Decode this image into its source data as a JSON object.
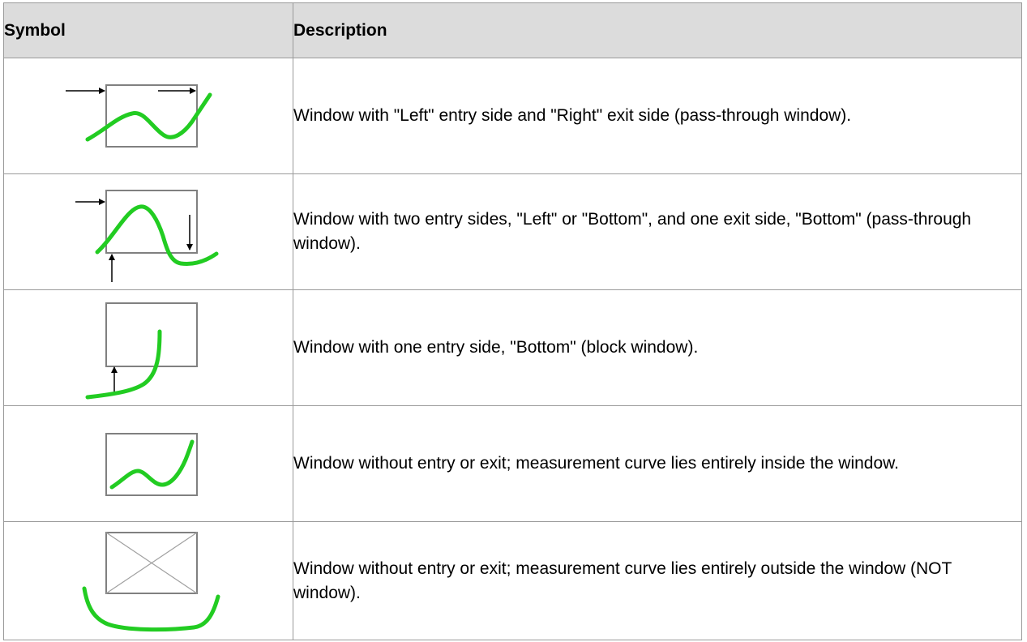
{
  "table": {
    "headers": {
      "symbol": "Symbol",
      "description": "Description"
    },
    "rows": [
      {
        "symbol_icon": "pass-through-window-left-right-icon",
        "description": "Window with \"Left\" entry side and \"Right\" exit side (pass-through window)."
      },
      {
        "symbol_icon": "pass-through-window-left-bottom-icon",
        "description": "Window with two entry sides, \"Left\" or \"Bottom\", and one exit side, \"Bottom\" (pass-through window)."
      },
      {
        "symbol_icon": "block-window-bottom-icon",
        "description": "Window with one entry side, \"Bottom\" (block window)."
      },
      {
        "symbol_icon": "curve-inside-window-icon",
        "description": "Window without entry or exit; measurement curve lies entirely inside the window."
      },
      {
        "symbol_icon": "not-window-icon",
        "description": "Window without entry or exit; measurement curve lies entirely outside the window (NOT window)."
      }
    ]
  },
  "colors": {
    "curve": "#22cc22",
    "window_border": "#808080",
    "header_bg": "#dcdcdc"
  }
}
